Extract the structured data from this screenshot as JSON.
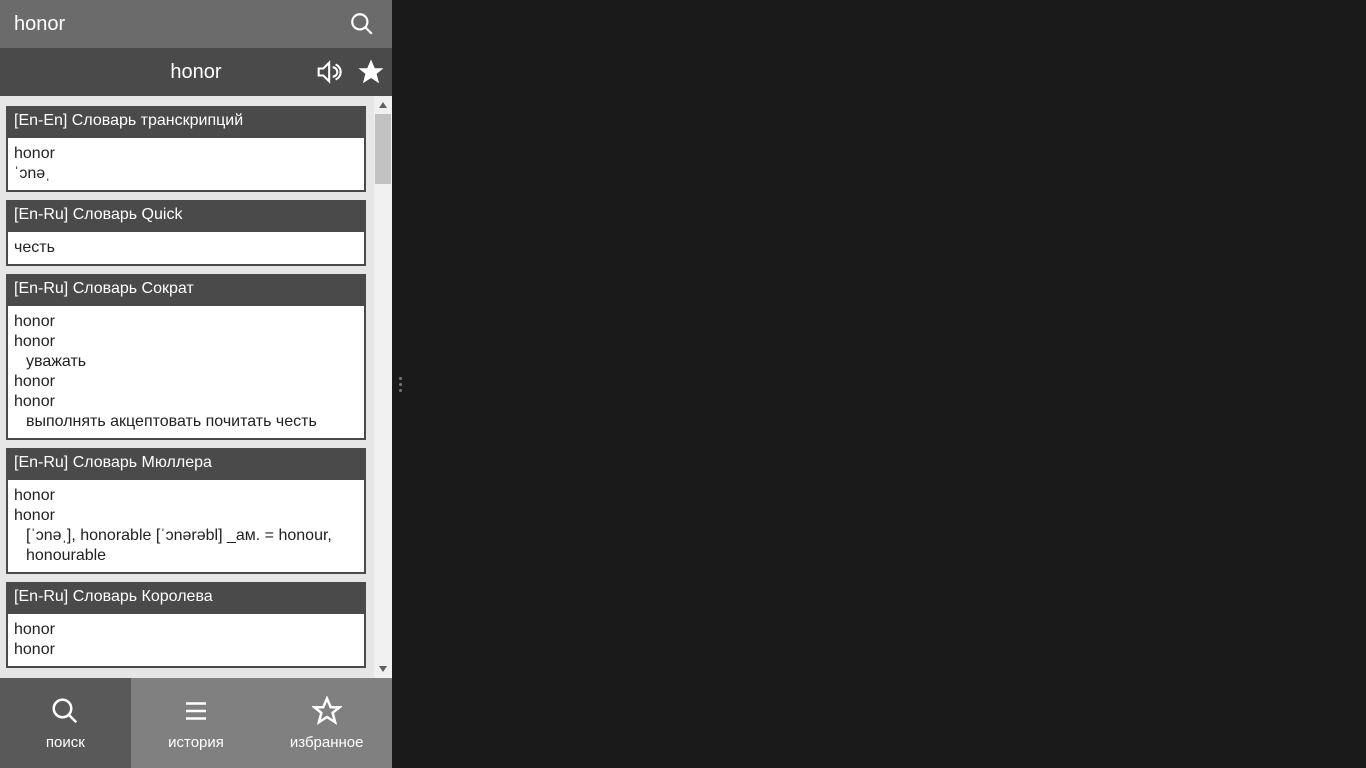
{
  "search": {
    "value": "honor"
  },
  "word": {
    "title": "honor"
  },
  "entries": [
    {
      "header": "[En-En] Словарь транскрипций",
      "lines": [
        {
          "text": "honor"
        },
        {
          "text": "ˈɔnəˌ"
        }
      ]
    },
    {
      "header": "[En-Ru] Словарь Quick",
      "lines": [
        {
          "text": "честь"
        }
      ]
    },
    {
      "header": "[En-Ru] Словарь Сократ",
      "lines": [
        {
          "text": "honor"
        },
        {
          "text": "honor"
        },
        {
          "text": "уважать",
          "indent": true
        },
        {
          "text": "honor"
        },
        {
          "text": "honor"
        },
        {
          "text": "выполнять акцептовать почитать честь",
          "indent": true
        }
      ]
    },
    {
      "header": "[En-Ru] Словарь Мюллера",
      "lines": [
        {
          "text": "honor"
        },
        {
          "text": "honor"
        },
        {
          "text": "[ˈɔnəˌ], honorable [ˈɔnərəbl] _ам. = honour, honourable",
          "indent": true
        }
      ]
    },
    {
      "header": "[En-Ru] Словарь Королева",
      "lines": [
        {
          "text": "honor"
        },
        {
          "text": "honor"
        }
      ]
    }
  ],
  "nav": {
    "search": "поиск",
    "history": "история",
    "favorites": "избранное"
  }
}
